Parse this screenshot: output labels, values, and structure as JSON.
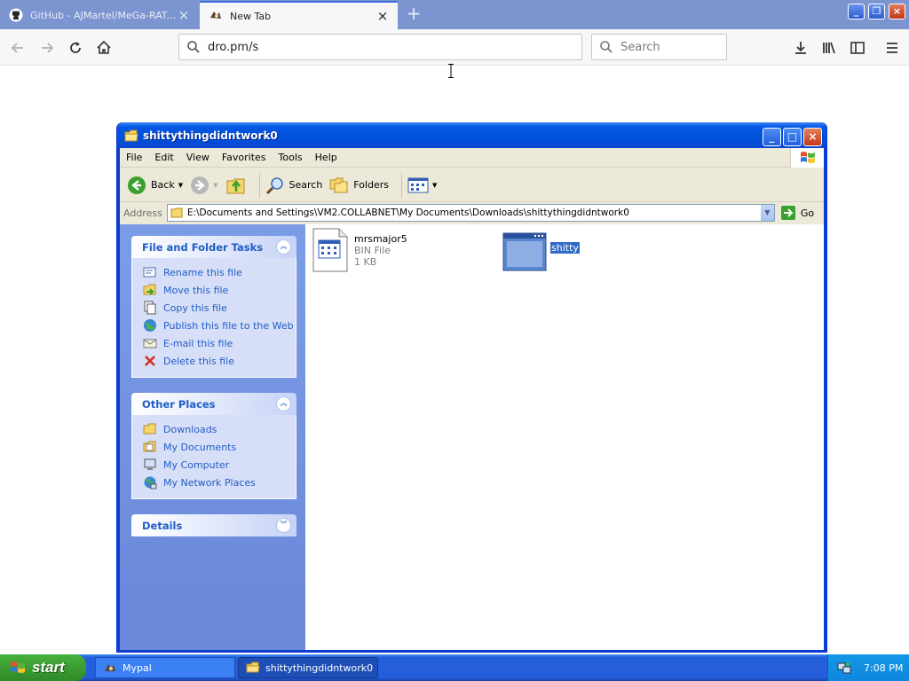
{
  "browser": {
    "tabs": [
      {
        "title": "GitHub - AJMartel/MeGa-RAT-Pac",
        "active": false
      },
      {
        "title": "New Tab",
        "active": true
      }
    ],
    "url": "dro.pm/s",
    "search_placeholder": "Search"
  },
  "explorer": {
    "title": "shittythingdidntwork0",
    "menu": [
      "File",
      "Edit",
      "View",
      "Favorites",
      "Tools",
      "Help"
    ],
    "toolbar": {
      "back": "Back",
      "search": "Search",
      "folders": "Folders"
    },
    "address_label": "Address",
    "address_path": "E:\\Documents and Settings\\VM2.COLLABNET\\My Documents\\Downloads\\shittythingdidntwork0",
    "go_label": "Go",
    "tasks_panel": {
      "title": "File and Folder Tasks",
      "items": [
        {
          "label": "Rename this file",
          "icon": "rename-icon"
        },
        {
          "label": "Move this file",
          "icon": "move-icon"
        },
        {
          "label": "Copy this file",
          "icon": "copy-icon"
        },
        {
          "label": "Publish this file to the Web",
          "icon": "publish-web-icon"
        },
        {
          "label": "E-mail this file",
          "icon": "email-icon"
        },
        {
          "label": "Delete this file",
          "icon": "delete-icon"
        }
      ]
    },
    "places_panel": {
      "title": "Other Places",
      "items": [
        {
          "label": "Downloads",
          "icon": "folder-icon"
        },
        {
          "label": "My Documents",
          "icon": "my-documents-icon"
        },
        {
          "label": "My Computer",
          "icon": "my-computer-icon"
        },
        {
          "label": "My Network Places",
          "icon": "network-places-icon"
        }
      ]
    },
    "details_panel": {
      "title": "Details"
    },
    "files": [
      {
        "name": "mrsmajor5",
        "type": "BIN File",
        "size": "1 KB",
        "selected": false
      },
      {
        "name": "shitty",
        "selected": true
      }
    ]
  },
  "taskbar": {
    "start_label": "start",
    "buttons": [
      {
        "label": "Mypal",
        "active": false
      },
      {
        "label": "shittythingdidntwork0",
        "active": true
      }
    ],
    "clock": "7:08 PM"
  },
  "colors": {
    "xp_title_blue": "#0050dc",
    "taskbar_blue": "#245edb",
    "start_green": "#3c9c33",
    "panel_link_blue": "#215dc6",
    "selection_blue": "#316ac5",
    "tab_accent": "#3a6fd8"
  }
}
